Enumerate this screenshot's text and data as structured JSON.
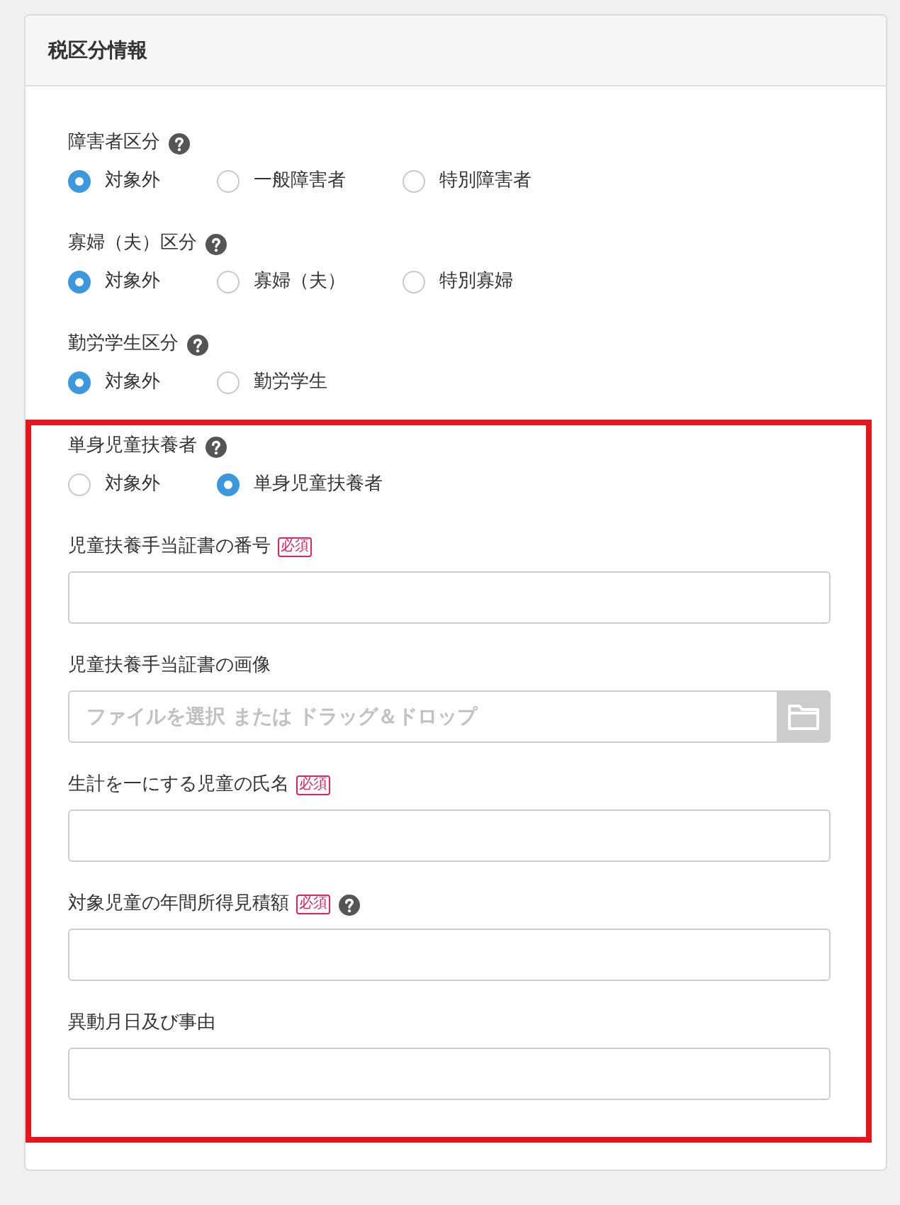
{
  "panel": {
    "title": "税区分情報",
    "sections": [
      {
        "highlighted": false,
        "fields": [
          {
            "kind": "radio",
            "label": "障害者区分",
            "help": true,
            "options": [
              {
                "label": "対象外",
                "selected": true
              },
              {
                "label": "一般障害者",
                "selected": false
              },
              {
                "label": "特別障害者",
                "selected": false
              }
            ]
          },
          {
            "kind": "radio",
            "label": "寡婦（夫）区分",
            "help": true,
            "options": [
              {
                "label": "対象外",
                "selected": true
              },
              {
                "label": "寡婦（夫）",
                "selected": false
              },
              {
                "label": "特別寡婦",
                "selected": false
              }
            ]
          },
          {
            "kind": "radio",
            "label": "勤労学生区分",
            "help": true,
            "options": [
              {
                "label": "対象外",
                "selected": true
              },
              {
                "label": "勤労学生",
                "selected": false
              }
            ]
          }
        ]
      },
      {
        "highlighted": true,
        "fields": [
          {
            "kind": "radio",
            "label": "単身児童扶養者",
            "help": true,
            "options": [
              {
                "label": "対象外",
                "selected": false
              },
              {
                "label": "単身児童扶養者",
                "selected": true
              }
            ]
          },
          {
            "kind": "text",
            "label": "児童扶養手当証書の番号",
            "required_badge": "必須",
            "help": false
          },
          {
            "kind": "file",
            "label": "児童扶養手当証書の画像",
            "placeholder": "ファイルを選択 または ドラッグ＆ドロップ",
            "help": false
          },
          {
            "kind": "text",
            "label": "生計を一にする児童の氏名",
            "required_badge": "必須",
            "help": false
          },
          {
            "kind": "text",
            "label": "対象児童の年間所得見積額",
            "required_badge": "必須",
            "help": true
          },
          {
            "kind": "text",
            "label": "異動月日及び事由",
            "help": false
          }
        ]
      }
    ]
  }
}
